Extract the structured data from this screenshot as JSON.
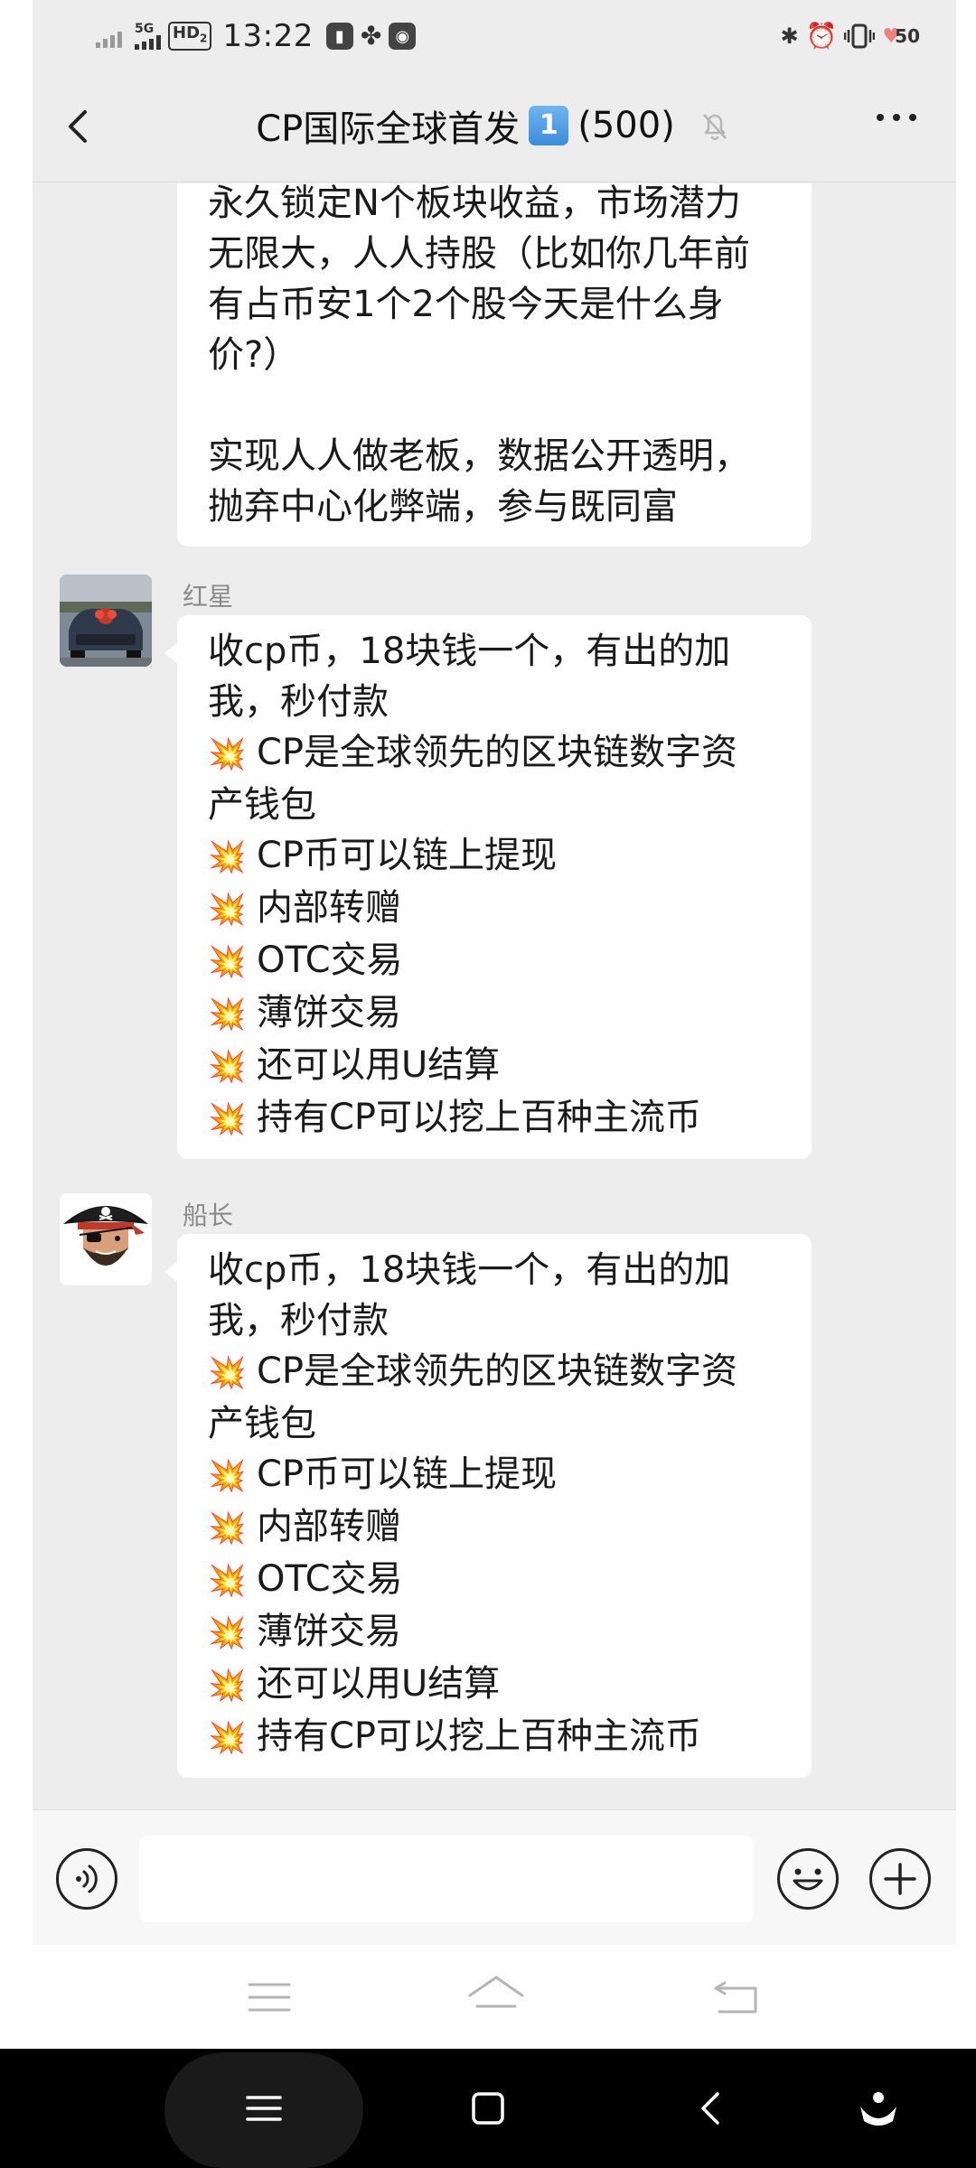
{
  "status_bar": {
    "network": "5G",
    "hd_badge": "HD",
    "hd_sub": "2",
    "time": "13:22",
    "battery": "50"
  },
  "header": {
    "title": "CP国际全球首发",
    "title_keycap": "1",
    "member_count": "(500)"
  },
  "messages": [
    {
      "sender": "",
      "continued": true,
      "lines": [
        "永久锁定N个板块收益，市场潜力",
        "无限大，人人持股（比如你几年前",
        "有占币安1个2个股今天是什么身",
        "价?）",
        "",
        "实现人人做老板，数据公开透明，",
        "抛弃中心化弊端，参与既同富"
      ]
    },
    {
      "sender": "红星",
      "lines": [
        "收cp币，18块钱一个，有出的加",
        "我，秒付款"
      ],
      "items": [
        "CP是全球领先的区块链数字资",
        "产钱包",
        "CP币可以链上提现",
        "内部转赠",
        "OTC交易",
        "薄饼交易",
        "还可以用U结算",
        "持有CP可以挖上百种主流币"
      ]
    },
    {
      "sender": "船长",
      "lines": [
        "收cp币，18块钱一个，有出的加",
        "我，秒付款"
      ],
      "items": [
        "CP是全球领先的区块链数字资",
        "产钱包",
        "CP币可以链上提现",
        "内部转赠",
        "OTC交易",
        "薄饼交易",
        "还可以用U结算",
        "持有CP可以挖上百种主流币"
      ]
    }
  ],
  "icons": {
    "back": "chevron-left-icon",
    "mute": "bell-off-icon",
    "more": "more-horizontal-icon",
    "voice": "voice-icon",
    "emoji": "emoji-icon",
    "plus": "plus-icon",
    "bullet": "collision-emoji-icon",
    "bullet_glyph": "💥"
  },
  "colors": {
    "chat_background": "#ededed",
    "bubble": "#ffffff",
    "sender_name": "#8a8a8a",
    "keycap": "#3a8ddc"
  }
}
